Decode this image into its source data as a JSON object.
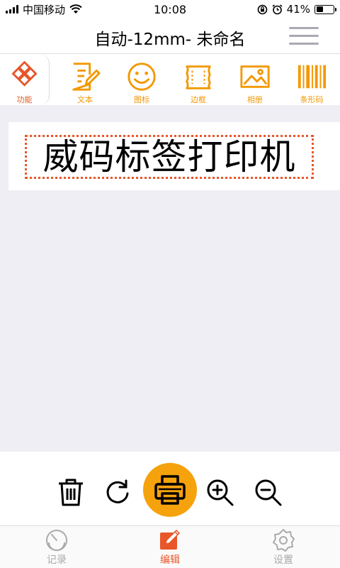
{
  "status_bar": {
    "carrier": "中国移动",
    "time": "10:08",
    "battery": "41%",
    "battery_level": 0.41
  },
  "nav": {
    "title": "自动-12mm- 未命名"
  },
  "toolbar": {
    "items": [
      {
        "label": "功能",
        "icon": "function-icon"
      },
      {
        "label": "文本",
        "icon": "text-edit-icon"
      },
      {
        "label": "图标",
        "icon": "smiley-icon"
      },
      {
        "label": "边框",
        "icon": "border-icon"
      },
      {
        "label": "相册",
        "icon": "photo-icon"
      },
      {
        "label": "条形码",
        "icon": "barcode-icon"
      }
    ]
  },
  "canvas": {
    "text": "威码标签打印机"
  },
  "actions": {
    "items": [
      "trash-icon",
      "rotate-icon",
      "printer-icon",
      "zoom-in-icon",
      "zoom-out-icon"
    ]
  },
  "tabs": [
    {
      "label": "记录",
      "icon": "clock-icon"
    },
    {
      "label": "编辑",
      "icon": "edit-icon"
    },
    {
      "label": "设置",
      "icon": "gear-icon"
    }
  ],
  "colors": {
    "accent": "#f39800",
    "active": "#e8562a",
    "print_button": "#f5a20d"
  }
}
